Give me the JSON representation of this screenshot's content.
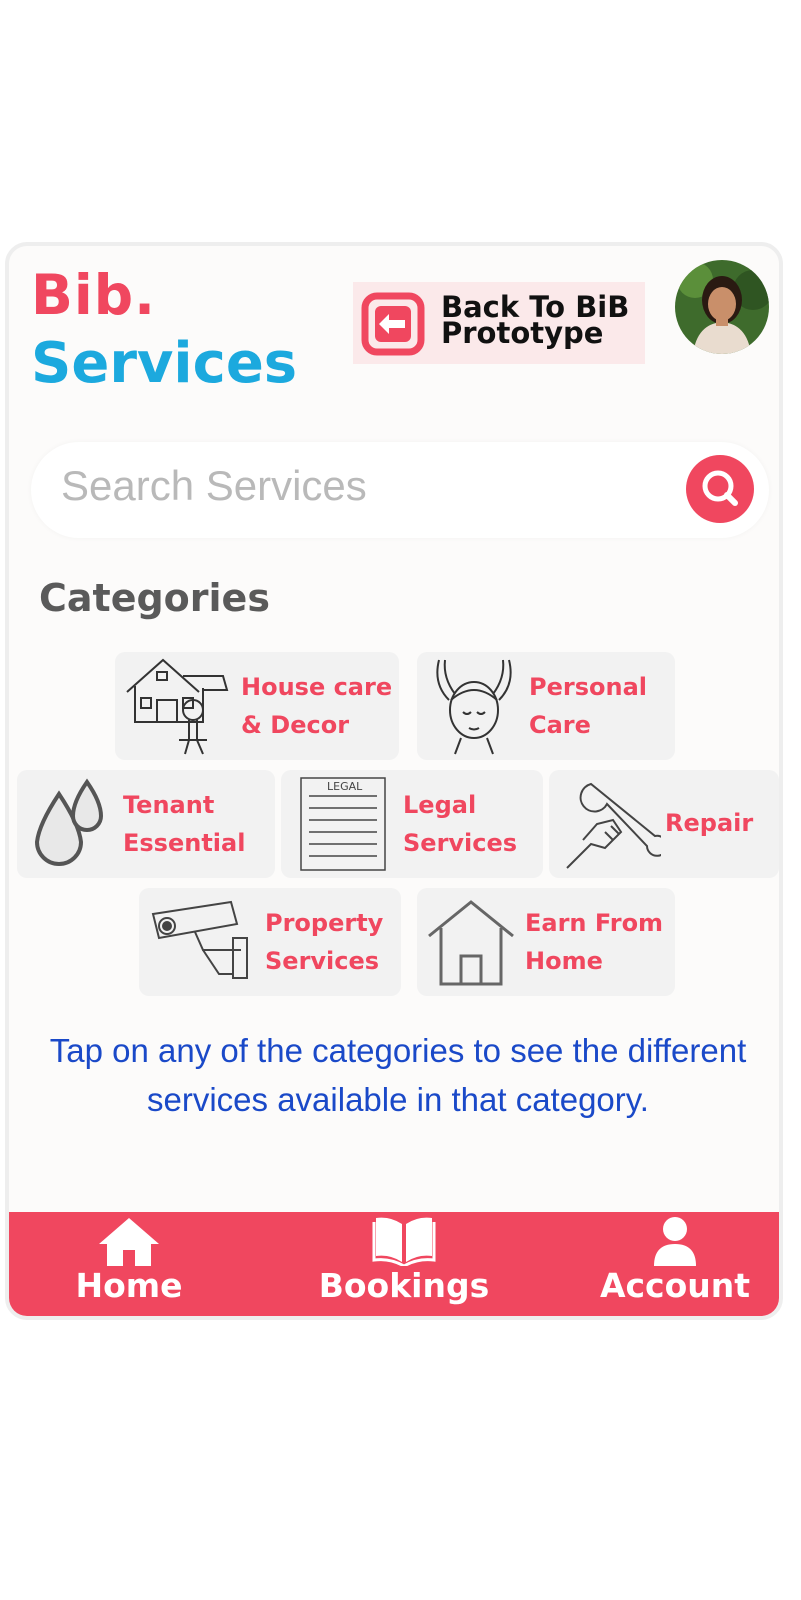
{
  "brand": {
    "line1": "Bib.",
    "line2": "Services",
    "primary_color": "#f0475f",
    "secondary_color": "#1ca9de"
  },
  "back_button": {
    "line1": "Back To BiB",
    "line2": "Prototype",
    "icon": "arrow-left-icon"
  },
  "profile": {
    "icon": "avatar"
  },
  "search": {
    "placeholder": "Search Services",
    "icon": "search-icon"
  },
  "categories": {
    "title": "Categories",
    "items": [
      {
        "line1": "House care",
        "line2": "& Decor",
        "icon": "house-wrench-icon"
      },
      {
        "line1": "Personal",
        "line2": "Care",
        "icon": "facial-massage-icon"
      },
      {
        "line1": "Tenant",
        "line2": "Essential",
        "icon": "water-drops-icon"
      },
      {
        "line1": "Legal",
        "line2": "Services",
        "icon": "legal-document-icon",
        "icon_text": "LEGAL"
      },
      {
        "line1": "Repair",
        "line2": "",
        "icon": "wrench-hand-icon"
      },
      {
        "line1": "Property",
        "line2": "Services",
        "icon": "cctv-camera-icon"
      },
      {
        "line1": "Earn From",
        "line2": "Home",
        "icon": "house-outline-icon"
      }
    ]
  },
  "help_text": "Tap on any of the categories to see the different services available in that category.",
  "nav": {
    "items": [
      {
        "label": "Home",
        "icon": "home-icon"
      },
      {
        "label": "Bookings",
        "icon": "book-icon"
      },
      {
        "label": "Account",
        "icon": "person-icon"
      }
    ]
  }
}
